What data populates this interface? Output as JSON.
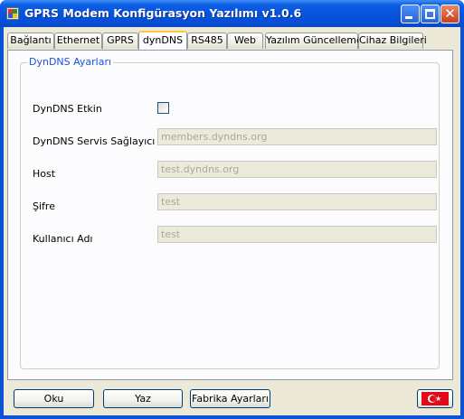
{
  "window": {
    "title": "GPRS Modem Konfigürasyon Yazılımı v1.0.6"
  },
  "tabs": [
    {
      "label": "Bağlantı"
    },
    {
      "label": "Ethernet"
    },
    {
      "label": "GPRS"
    },
    {
      "label": "dynDNS",
      "active": true
    },
    {
      "label": "RS485"
    },
    {
      "label": "Web"
    },
    {
      "label": "Yazılım Güncelleme"
    },
    {
      "label": "Cihaz Bilgileri"
    }
  ],
  "dyndns": {
    "group_title": "DynDNS Ayarları",
    "enabled_label": "DynDNS Etkin",
    "enabled": false,
    "service_label": "DynDNS Servis Sağlayıcı",
    "service_value": "members.dyndns.org",
    "host_label": "Host",
    "host_value": "test.dyndns.org",
    "password_label": "Şifre",
    "password_value": "test",
    "username_label": "Kullanıcı Adı",
    "username_value": "test"
  },
  "buttons": {
    "read": "Oku",
    "write": "Yaz",
    "factory": "Fabrika Ayarları",
    "language_icon": "turkish-flag-icon"
  },
  "colors": {
    "title_bar": "#0753df",
    "group_caption": "#2150e0",
    "active_tab_accent": "#ffc83c",
    "flag_red": "#e30a17"
  }
}
